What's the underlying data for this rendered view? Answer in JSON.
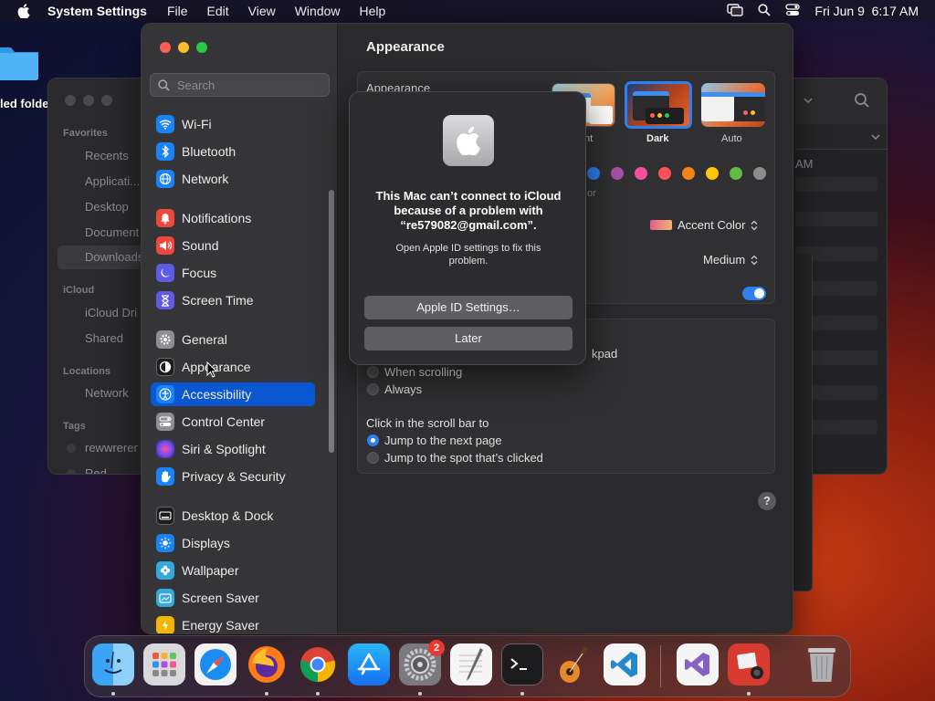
{
  "menubar": {
    "app_name": "System Settings",
    "menus": [
      "File",
      "Edit",
      "View",
      "Window",
      "Help"
    ],
    "clock": "Fri Jun 9  6:17 AM"
  },
  "desktop": {
    "folder_label": "led folde"
  },
  "finder": {
    "favorites_title": "Favorites",
    "favorites": [
      "Recents",
      "Applicati...",
      "Desktop",
      "Document",
      "Downloads"
    ],
    "icloud_title": "iCloud",
    "icloud": [
      "iCloud Dri",
      "Shared"
    ],
    "locations_title": "Locations",
    "locations": [
      "Network"
    ],
    "tags_title": "Tags",
    "tags": [
      "rewwrerer",
      "Red"
    ],
    "column_label": "AM"
  },
  "settings": {
    "search_placeholder": "Search",
    "sidebar": [
      {
        "label": "Wi-Fi",
        "icon": "wifi-icon",
        "color": "#1a82f7"
      },
      {
        "label": "Bluetooth",
        "icon": "bluetooth-icon",
        "color": "#1a82f7"
      },
      {
        "label": "Network",
        "icon": "globe-icon",
        "color": "#1a82f7"
      },
      {
        "label": "Notifications",
        "icon": "bell-icon",
        "color": "#f0463c"
      },
      {
        "label": "Sound",
        "icon": "speaker-icon",
        "color": "#f0463c"
      },
      {
        "label": "Focus",
        "icon": "moon-icon",
        "color": "#5e5ce6"
      },
      {
        "label": "Screen Time",
        "icon": "hourglass-icon",
        "color": "#5e5ce6"
      },
      {
        "label": "General",
        "icon": "gear-icon",
        "color": "#8e8e93"
      },
      {
        "label": "Appearance",
        "icon": "appearance-icon",
        "color": "#1c1c1e"
      },
      {
        "label": "Accessibility",
        "icon": "accessibility-icon",
        "color": "#1a82f7"
      },
      {
        "label": "Control Center",
        "icon": "control-center-icon",
        "color": "#8e8e93"
      },
      {
        "label": "Siri & Spotlight",
        "icon": "siri-icon",
        "color": "#b548d8"
      },
      {
        "label": "Privacy & Security",
        "icon": "hand-icon",
        "color": "#1a82f7"
      },
      {
        "label": "Desktop & Dock",
        "icon": "dock-icon",
        "color": "#1c1c1e"
      },
      {
        "label": "Displays",
        "icon": "sun-icon",
        "color": "#1a82f7"
      },
      {
        "label": "Wallpaper",
        "icon": "flower-icon",
        "color": "#34aadc"
      },
      {
        "label": "Screen Saver",
        "icon": "screensaver-icon",
        "color": "#34aadc"
      },
      {
        "label": "Energy Saver",
        "icon": "battery-icon",
        "color": "#f4b400"
      }
    ],
    "selected_item": "Accessibility",
    "content_title": "Appearance",
    "appearance_label": "Appearance",
    "theme_light_caption": "nt",
    "theme_dark_caption": "Dark",
    "theme_auto_caption": "Auto",
    "accent_colors": [
      "#2f7ff0",
      "#a550a7",
      "#f74f9e",
      "#ff5257",
      "#f7821b",
      "#ffc600",
      "#62ba46",
      "#8c8c8c"
    ],
    "highlight_fragment": "or",
    "accent_popup": "Accent Color",
    "sidebar_icon_size": "Medium",
    "scroll_fragment": "kpad",
    "scroll_options": [
      "When scrolling",
      "Always"
    ],
    "click_label": "Click in the scroll bar to",
    "click_options": [
      "Jump to the next page",
      "Jump to the spot that’s clicked"
    ],
    "help": "?"
  },
  "alert": {
    "title": "This Mac can’t connect to iCloud because of a problem with “re579082@gmail.com”.",
    "message": "Open Apple ID settings to fix this problem.",
    "primary_button": "Apple ID Settings…",
    "secondary_button": "Later"
  },
  "dock": {
    "apps": [
      "Finder",
      "Launchpad",
      "Safari",
      "Firefox",
      "Chrome",
      "App Store",
      "System Settings",
      "TextEdit",
      "Terminal",
      "GarageBand",
      "VS Code",
      "Visual Studio",
      "Photo Booth",
      "Trash"
    ],
    "settings_badge": "2"
  }
}
